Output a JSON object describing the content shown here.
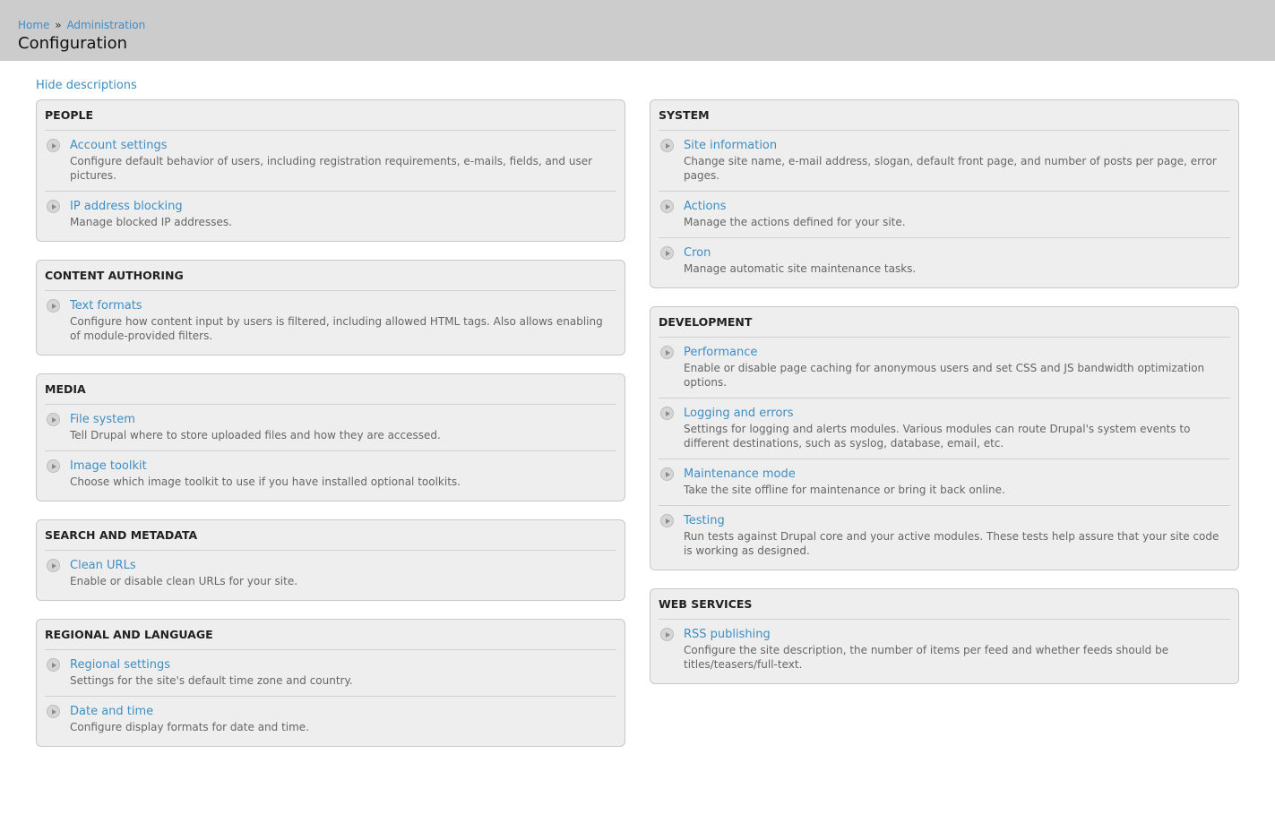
{
  "breadcrumb": {
    "home": "Home",
    "separator": "»",
    "administration": "Administration"
  },
  "page_title": "Configuration",
  "toggle_descriptions": "Hide descriptions",
  "left_column": [
    {
      "title": "PEOPLE",
      "items": [
        {
          "label": "Account settings",
          "description": "Configure default behavior of users, including registration requirements, e-mails, fields, and user pictures."
        },
        {
          "label": "IP address blocking",
          "description": "Manage blocked IP addresses."
        }
      ]
    },
    {
      "title": "CONTENT AUTHORING",
      "items": [
        {
          "label": "Text formats",
          "description": "Configure how content input by users is filtered, including allowed HTML tags. Also allows enabling of module-provided filters."
        }
      ]
    },
    {
      "title": "MEDIA",
      "items": [
        {
          "label": "File system",
          "description": "Tell Drupal where to store uploaded files and how they are accessed."
        },
        {
          "label": "Image toolkit",
          "description": "Choose which image toolkit to use if you have installed optional toolkits."
        }
      ]
    },
    {
      "title": "SEARCH AND METADATA",
      "items": [
        {
          "label": "Clean URLs",
          "description": "Enable or disable clean URLs for your site."
        }
      ]
    },
    {
      "title": "REGIONAL AND LANGUAGE",
      "items": [
        {
          "label": "Regional settings",
          "description": "Settings for the site's default time zone and country."
        },
        {
          "label": "Date and time",
          "description": "Configure display formats for date and time."
        }
      ]
    }
  ],
  "right_column": [
    {
      "title": "SYSTEM",
      "items": [
        {
          "label": "Site information",
          "description": "Change site name, e-mail address, slogan, default front page, and number of posts per page, error pages."
        },
        {
          "label": "Actions",
          "description": "Manage the actions defined for your site."
        },
        {
          "label": "Cron",
          "description": "Manage automatic site maintenance tasks."
        }
      ]
    },
    {
      "title": "DEVELOPMENT",
      "items": [
        {
          "label": "Performance",
          "description": "Enable or disable page caching for anonymous users and set CSS and JS bandwidth optimization options."
        },
        {
          "label": "Logging and errors",
          "description": "Settings for logging and alerts modules. Various modules can route Drupal's system events to different destinations, such as syslog, database, email, etc."
        },
        {
          "label": "Maintenance mode",
          "description": "Take the site offline for maintenance or bring it back online."
        },
        {
          "label": "Testing",
          "description": "Run tests against Drupal core and your active modules. These tests help assure that your site code is working as designed."
        }
      ]
    },
    {
      "title": "WEB SERVICES",
      "items": [
        {
          "label": "RSS publishing",
          "description": "Configure the site description, the number of items per feed and whether feeds should be titles/teasers/full-text."
        }
      ]
    }
  ]
}
